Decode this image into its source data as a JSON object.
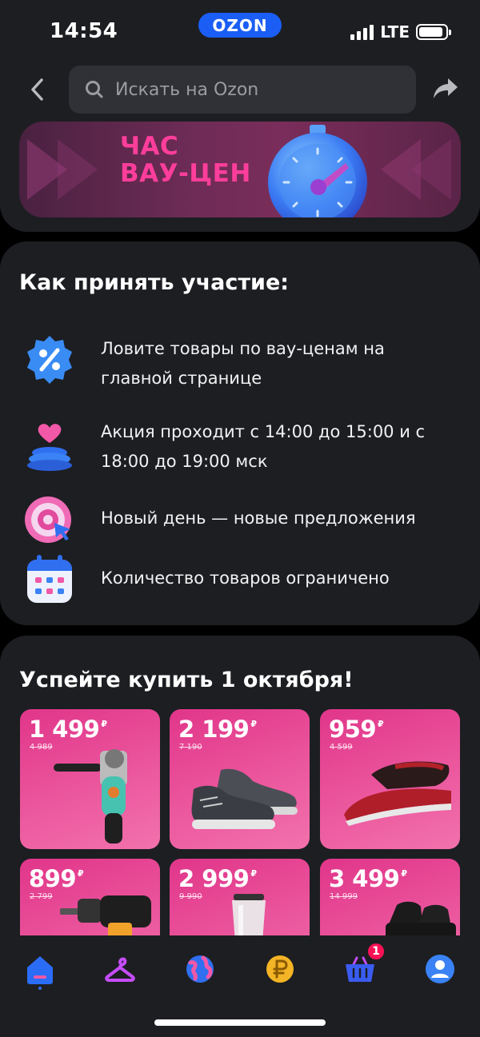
{
  "status_bar": {
    "time": "14:54",
    "carrier_logo": "OZON",
    "network": "LTE",
    "battery_level": 0.9
  },
  "search": {
    "placeholder": "Искать на Ozon"
  },
  "banner": {
    "title_line1": "ЧАС",
    "title_line2": "ВАУ-ЦЕН"
  },
  "howto": {
    "title": "Как принять участие:",
    "steps": [
      {
        "icon": "percent-badge-icon",
        "text": "Ловите товары по вау-ценам на главной странице"
      },
      {
        "icon": "heart-gift-icon",
        "text": "Акция проходит с 14:00 до 15:00 и с 18:00 до 19:00 мск"
      },
      {
        "icon": "target-cursor-icon",
        "text": "Новый день — новые предложения"
      },
      {
        "icon": "calendar-icon",
        "text": "Количество товаров ограничено"
      }
    ]
  },
  "products": {
    "title": "Успейте купить 1 октября!",
    "currency": "₽",
    "items": [
      {
        "price": "1 499",
        "old_price": "4 989",
        "image": "angle-grinder"
      },
      {
        "price": "2 199",
        "old_price": "7 190",
        "image": "sneakers"
      },
      {
        "price": "959",
        "old_price": "4 599",
        "image": "steam-iron"
      },
      {
        "price": "899",
        "old_price": "2 799",
        "image": "cordless-drill"
      },
      {
        "price": "2 999",
        "old_price": "9 990",
        "image": "blender"
      },
      {
        "price": "3 499",
        "old_price": "14 999",
        "image": "boots"
      }
    ]
  },
  "tabbar": {
    "items": [
      "home-icon",
      "catalog-hanger-icon",
      "fresh-globe-icon",
      "points-ruble-icon",
      "cart-icon",
      "profile-icon"
    ],
    "cart_badge": "1",
    "colors": {
      "home": "#2a6cf5",
      "hanger": "#c64dff",
      "cart": "#3a5cf0",
      "badge": "#f91155"
    }
  },
  "colors": {
    "background": "#1d1e22",
    "accent": "#1b5ef5",
    "tile": "#e1358a",
    "banner_text": "#ff3e9b"
  }
}
